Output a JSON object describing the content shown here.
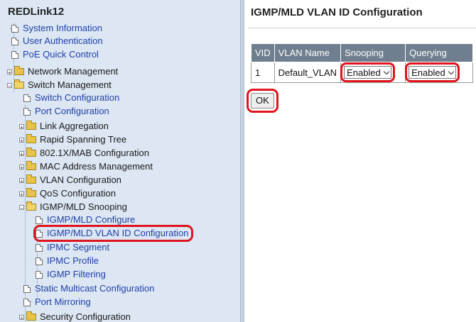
{
  "sidebar": {
    "device_name": "REDLink12",
    "items": [
      {
        "label": "System Information",
        "type": "page"
      },
      {
        "label": "User Authentication",
        "type": "page"
      },
      {
        "label": "PoE Quick Control",
        "type": "page"
      },
      {
        "label": "Network Management",
        "type": "folder-collapsed"
      },
      {
        "label": "Switch Management",
        "type": "folder-expanded"
      },
      {
        "label": "Switch Configuration",
        "type": "page"
      },
      {
        "label": "Port Configuration",
        "type": "page"
      },
      {
        "label": "Link Aggregation",
        "type": "folder-collapsed"
      },
      {
        "label": "Rapid Spanning Tree",
        "type": "folder-collapsed"
      },
      {
        "label": "802.1X/MAB Configuration",
        "type": "folder-collapsed"
      },
      {
        "label": "MAC Address Management",
        "type": "folder-collapsed"
      },
      {
        "label": "VLAN Configuration",
        "type": "folder-collapsed"
      },
      {
        "label": "QoS Configuration",
        "type": "folder-collapsed"
      },
      {
        "label": "IGMP/MLD Snooping",
        "type": "folder-expanded"
      },
      {
        "label": "IGMP/MLD Configure",
        "type": "page"
      },
      {
        "label": "IGMP/MLD VLAN ID Configuration",
        "type": "page",
        "selected": true
      },
      {
        "label": "IPMC Segment",
        "type": "page"
      },
      {
        "label": "IPMC Profile",
        "type": "page"
      },
      {
        "label": "IGMP Filtering",
        "type": "page"
      },
      {
        "label": "Static Multicast Configuration",
        "type": "page"
      },
      {
        "label": "Port Mirroring",
        "type": "page"
      },
      {
        "label": "Security Configuration",
        "type": "folder-collapsed"
      }
    ]
  },
  "main": {
    "title": "IGMP/MLD VLAN ID Configuration",
    "table": {
      "headers": [
        "VID",
        "VLAN Name",
        "Snooping",
        "Querying"
      ],
      "rows": [
        {
          "vid": "1",
          "vlan_name": "Default_VLAN",
          "snooping": "Enabled",
          "querying": "Enabled"
        }
      ]
    },
    "ok_label": "OK"
  },
  "colors": {
    "sidebar_bg": "#dce7f3",
    "link": "#1f3fa8",
    "table_header_bg": "#6f7f8f",
    "highlight": "#e0141e"
  },
  "icons": {
    "page": "page-icon",
    "folder": "folder-icon",
    "expand": "plus-icon",
    "collapse": "minus-icon",
    "dropdown": "chevron-down-icon"
  }
}
